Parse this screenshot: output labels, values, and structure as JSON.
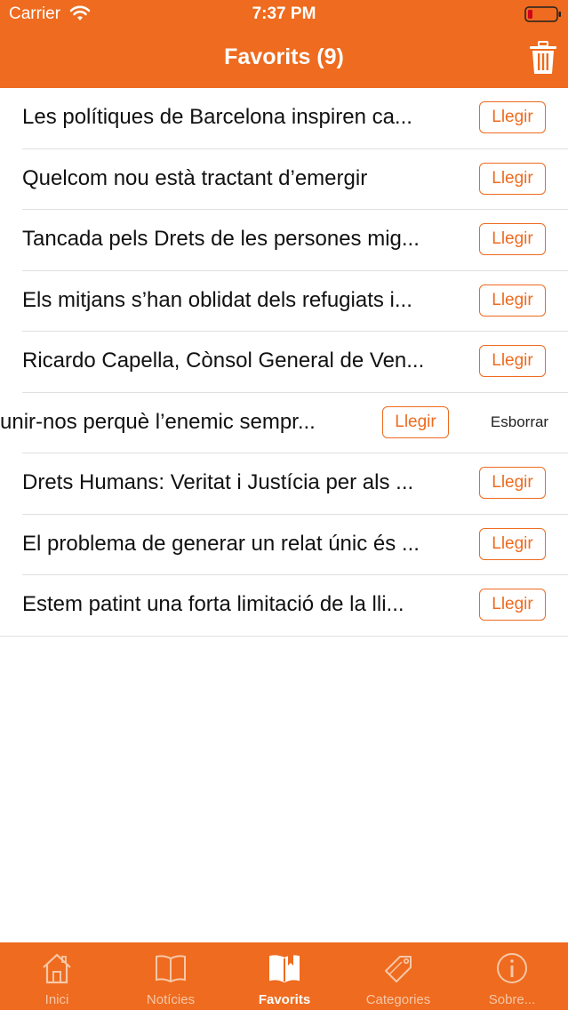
{
  "status": {
    "carrier": "Carrier",
    "time": "7:37 PM"
  },
  "nav": {
    "title": "Favorits (9)"
  },
  "colors": {
    "accent": "#ee6b1f",
    "tab_inactive": "#f7c7a7"
  },
  "favorites": [
    {
      "title": "Les polítiques de Barcelona inspiren ca...",
      "action": "Llegir"
    },
    {
      "title": "Quelcom nou està tractant d’emergir",
      "action": "Llegir"
    },
    {
      "title": "Tancada pels Drets de les persones mig...",
      "action": "Llegir"
    },
    {
      "title": "Els mitjans s’han oblidat dels refugiats i...",
      "action": "Llegir"
    },
    {
      "title": "Ricardo Capella, Cònsol General de Ven...",
      "action": "Llegir"
    },
    {
      "title": "unir-nos perquè l’enemic sempr...",
      "action": "Llegir",
      "delete": "Esborrar"
    },
    {
      "title": "Drets Humans: Veritat i Justícia per als ...",
      "action": "Llegir"
    },
    {
      "title": "El problema de generar un relat únic és ...",
      "action": "Llegir"
    },
    {
      "title": "Estem patint una forta limitació de la lli...",
      "action": "Llegir"
    }
  ],
  "tabs": [
    {
      "label": "Inici",
      "icon": "house-icon"
    },
    {
      "label": "Notícies",
      "icon": "book-icon"
    },
    {
      "label": "Favorits",
      "icon": "bookmark-book-icon",
      "active": true
    },
    {
      "label": "Categories",
      "icon": "tag-icon"
    },
    {
      "label": "Sobre...",
      "icon": "info-icon"
    }
  ]
}
